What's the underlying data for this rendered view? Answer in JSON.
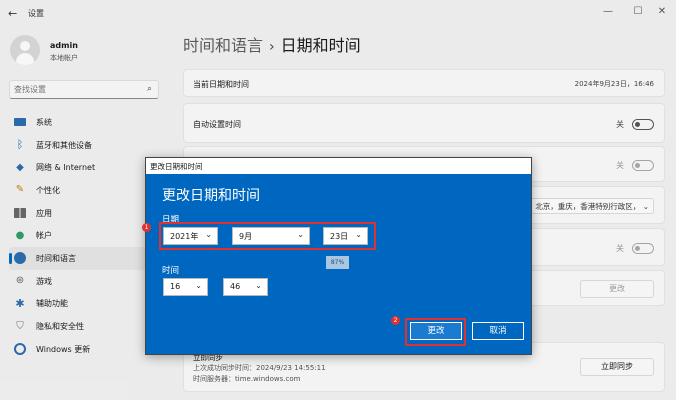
{
  "window": {
    "title": "设置",
    "controls": [
      "—",
      "☐",
      "✕"
    ]
  },
  "profile": {
    "name": "admin",
    "subtitle": "本地帐户"
  },
  "search": {
    "placeholder": "查找设置"
  },
  "sidebar": {
    "items": [
      {
        "label": "系统",
        "icon": "system-icon"
      },
      {
        "label": "蓝牙和其他设备",
        "icon": "bluetooth-icon"
      },
      {
        "label": "网络 & Internet",
        "icon": "network-icon"
      },
      {
        "label": "个性化",
        "icon": "pen-icon"
      },
      {
        "label": "应用",
        "icon": "apps-icon"
      },
      {
        "label": "帐户",
        "icon": "account-icon"
      },
      {
        "label": "时间和语言",
        "icon": "globe-clock-icon",
        "active": true
      },
      {
        "label": "游戏",
        "icon": "gamepad-icon"
      },
      {
        "label": "辅助功能",
        "icon": "accessibility-icon"
      },
      {
        "label": "隐私和安全性",
        "icon": "shield-icon"
      },
      {
        "label": "Windows 更新",
        "icon": "update-icon"
      }
    ]
  },
  "breadcrumb": {
    "parent": "时间和语言",
    "separator": "›",
    "current": "日期和时间"
  },
  "cards": {
    "current_datetime_label": "当前日期和时间",
    "current_datetime_value": "2024年9月23日，16:46",
    "auto_time_label": "自动设置时间",
    "auto_time_state": "关",
    "second_toggle_state": "关",
    "timezone_value": "北京，重庆，香港特别行政区，",
    "third_toggle_state": "关",
    "change_button": "更改",
    "sync_title": "立即同步",
    "sync_last": "上次成功同步时间：2024/9/23 14:55:11",
    "sync_server": "时间服务器：time.windows.com",
    "sync_button": "立即同步"
  },
  "dialog": {
    "window_title": "更改日期和时间",
    "heading": "更改日期和时间",
    "date_label": "日期",
    "year": "2021年",
    "month": "9月",
    "day": "23日",
    "time_label": "时间",
    "hour": "16",
    "minute": "46",
    "zoom": "87%",
    "change_button": "更改",
    "cancel_button": "取消",
    "badge_1": "1",
    "badge_2": "2"
  },
  "colors": {
    "accent": "#0067c0",
    "highlight": "#e03030"
  }
}
